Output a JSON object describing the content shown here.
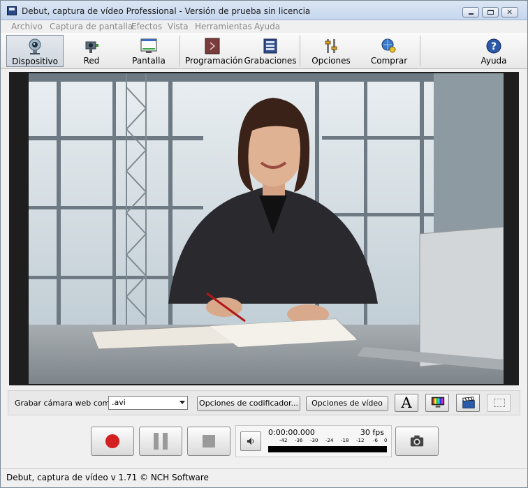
{
  "window": {
    "title": "Debut, captura de vídeo Professional - Versión de prueba sin licencia",
    "controls": {
      "minimize_icon": "minimize-icon",
      "maximize_icon": "maximize-icon",
      "close_glyph": "✕"
    }
  },
  "menu": {
    "items": [
      {
        "label": "Archivo"
      },
      {
        "label": "Captura de pantalla"
      },
      {
        "label": "Efectos"
      },
      {
        "label": "Vista"
      },
      {
        "label": "Herramientas"
      },
      {
        "label": "Ayuda"
      }
    ]
  },
  "toolbar": {
    "buttons": [
      {
        "label": "Dispositivo",
        "icon": "webcam-icon",
        "active": true
      },
      {
        "label": "Red",
        "icon": "network-camera-icon"
      },
      {
        "label": "Pantalla",
        "icon": "screen-icon"
      },
      {
        "label": "Programación",
        "icon": "schedule-icon"
      },
      {
        "label": "Grabaciones",
        "icon": "recordings-icon"
      },
      {
        "label": "Opciones",
        "icon": "options-icon"
      },
      {
        "label": "Comprar",
        "icon": "buy-icon"
      },
      {
        "label": "Ayuda",
        "icon": "help-icon"
      }
    ]
  },
  "preview": {
    "description_icon": "video-preview"
  },
  "capture": {
    "record_as_label": "Grabar cámara web como:",
    "format_value": ".avi",
    "encoder_options_label": "Opciones de codificador...",
    "video_options_label": "Opciones de vídeo",
    "text_overlay_glyph": "A"
  },
  "transport": {
    "record_icon": "record-icon",
    "pause_icon": "pause-icon",
    "stop_icon": "stop-icon",
    "volume_icon": "speaker-icon",
    "snapshot_icon": "camera-icon",
    "time": "0:00:00.000",
    "fps": "30 fps",
    "meter_ticks": [
      "-42",
      "-36",
      "-30",
      "-24",
      "-18",
      "-12",
      "-6",
      "0"
    ]
  },
  "status": {
    "text": "Debut, captura de vídeo v 1.71 © NCH Software"
  },
  "colors": {
    "record_red": "#d42020",
    "accent": "#2a5aa8"
  }
}
